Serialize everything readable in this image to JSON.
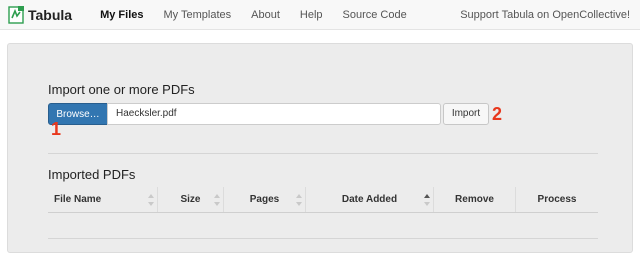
{
  "navbar": {
    "brand": "Tabula",
    "items": [
      {
        "label": "My Files",
        "active": true
      },
      {
        "label": "My Templates",
        "active": false
      },
      {
        "label": "About",
        "active": false
      },
      {
        "label": "Help",
        "active": false
      },
      {
        "label": "Source Code",
        "active": false
      }
    ],
    "support_link": "Support Tabula on OpenCollective!"
  },
  "import_section": {
    "title": "Import one or more PDFs",
    "browse_label": "Browse…",
    "file_value": "Haecksler.pdf",
    "import_label": "Import",
    "step_markers": [
      "1",
      "2"
    ]
  },
  "imported_section": {
    "title": "Imported PDFs",
    "columns": [
      "File Name",
      "Size",
      "Pages",
      "Date Added",
      "Remove",
      "Process"
    ],
    "rows": []
  },
  "colors": {
    "browse_button": "#3276b1",
    "step_marker": "#e8371c",
    "well_background": "#ececec"
  }
}
